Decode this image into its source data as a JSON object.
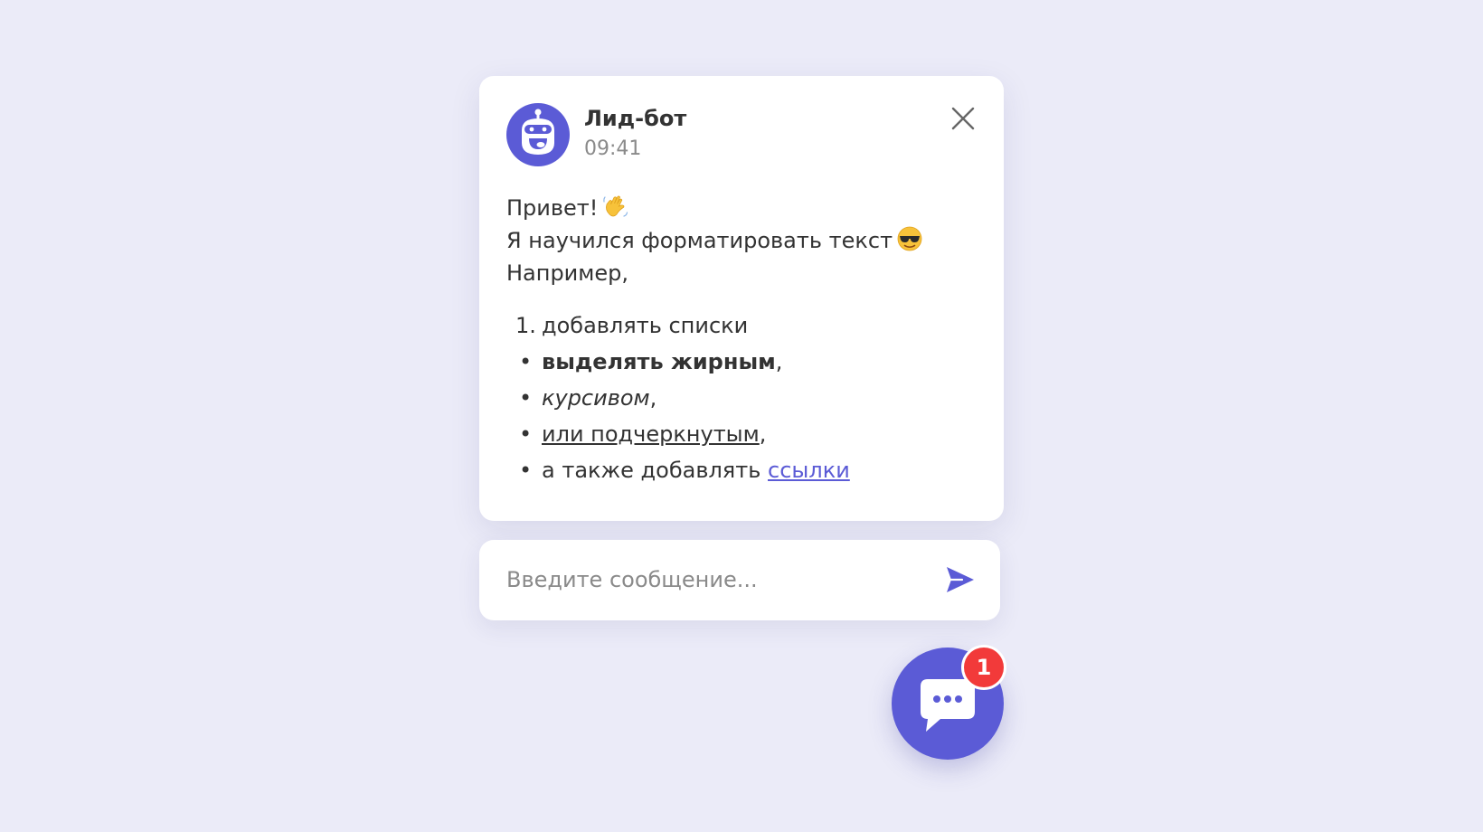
{
  "chat": {
    "bot_name": "Лид-бот",
    "time": "09:41",
    "close_icon": "close-icon",
    "message": {
      "greeting": "Привет!",
      "greeting_emoji": "waving-hand-emoji",
      "line2": "Я научился форматировать текст",
      "line2_emoji": "sunglasses-emoji",
      "line3": "Например,",
      "list": {
        "item1_marker": "1.",
        "item1": "добавлять списки",
        "item2_bold": "выделять жирным",
        "item3_italic": "курсивом",
        "item4_underline": "или подчеркнутым",
        "item5_text": "а также добавлять",
        "item5_link": "ссылки",
        "comma": ",",
        "bullet": "•"
      }
    }
  },
  "composer": {
    "placeholder": "Введите сообщение...",
    "value": "",
    "send_icon": "send-icon"
  },
  "launcher": {
    "icon": "chat-bubble-icon",
    "badge_count": "1"
  },
  "colors": {
    "background": "#ebebf8",
    "accent": "#5b5bd6",
    "badge": "#f23a3a",
    "text": "#333333",
    "muted": "#8a8a8a"
  }
}
